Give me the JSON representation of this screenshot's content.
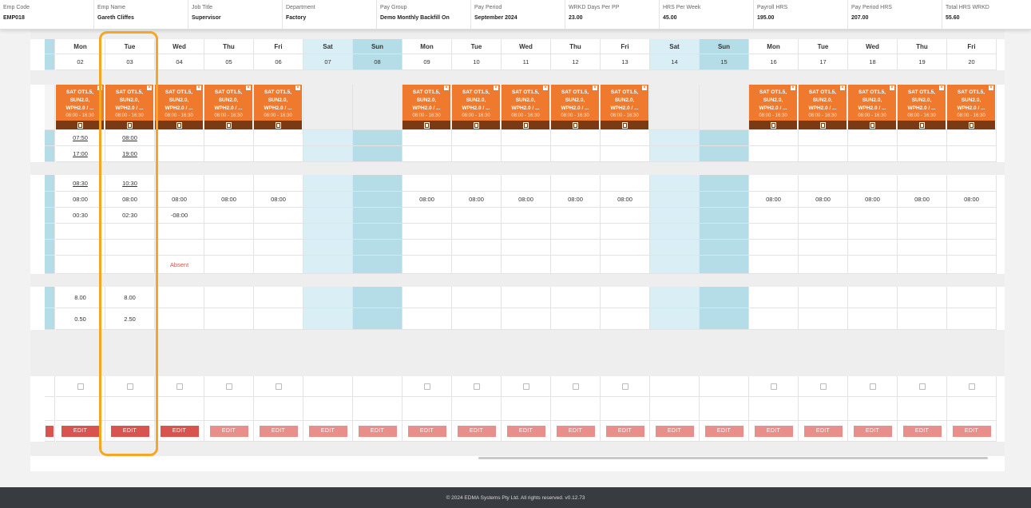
{
  "header": {
    "fields": [
      {
        "label": "Emp Code",
        "value": "EMP018"
      },
      {
        "label": "Emp Name",
        "value": "Gareth Cliffes"
      },
      {
        "label": "Job Title",
        "value": "Supervisor"
      },
      {
        "label": "Department",
        "value": "Factory"
      },
      {
        "label": "Pay Group",
        "value": "Demo Monthly Backfill On"
      },
      {
        "label": "Pay Period",
        "value": "September 2024"
      },
      {
        "label": "WRKD Days Per PP",
        "value": "23.00"
      },
      {
        "label": "HRS Per Week",
        "value": "45.00"
      },
      {
        "label": "Payroll HRS",
        "value": "195.00"
      },
      {
        "label": "Pay Period HRS",
        "value": "207.00"
      },
      {
        "label": "Total HRS WRKD",
        "value": "55.60"
      }
    ]
  },
  "days": [
    {
      "name": "Mon",
      "date": "02",
      "weekend": false,
      "roster": true,
      "start": "07:50",
      "end": "17:00",
      "start2": "08:30",
      "norm": "08:00",
      "diff": "00:30",
      "status": "",
      "hrs": "8.00",
      "ot": "0.50",
      "edit": "EDIT",
      "edit_active": true
    },
    {
      "name": "Tue",
      "date": "03",
      "weekend": false,
      "roster": true,
      "start": "08:00",
      "end": "19:00",
      "start2": "10:30",
      "norm": "08:00",
      "diff": "02:30",
      "status": "",
      "hrs": "8.00",
      "ot": "2.50",
      "edit": "EDIT",
      "edit_active": true
    },
    {
      "name": "Wed",
      "date": "04",
      "weekend": false,
      "roster": true,
      "start": "",
      "end": "",
      "start2": "",
      "norm": "08:00",
      "diff": "-08:00",
      "status": "Absent",
      "hrs": "",
      "ot": "",
      "edit": "EDIT",
      "edit_active": true
    },
    {
      "name": "Thu",
      "date": "05",
      "weekend": false,
      "roster": true,
      "start": "",
      "end": "",
      "start2": "",
      "norm": "08:00",
      "diff": "",
      "status": "",
      "hrs": "",
      "ot": "",
      "edit": "EDIT",
      "edit_active": false
    },
    {
      "name": "Fri",
      "date": "06",
      "weekend": false,
      "roster": true,
      "start": "",
      "end": "",
      "start2": "",
      "norm": "08:00",
      "diff": "",
      "status": "",
      "hrs": "",
      "ot": "",
      "edit": "EDIT",
      "edit_active": false
    },
    {
      "name": "Sat",
      "date": "07",
      "weekend": "sat",
      "roster": false,
      "start": "",
      "end": "",
      "start2": "",
      "norm": "",
      "diff": "",
      "status": "",
      "hrs": "",
      "ot": "",
      "edit": "EDIT",
      "edit_active": false
    },
    {
      "name": "Sun",
      "date": "08",
      "weekend": "sun",
      "roster": false,
      "start": "",
      "end": "",
      "start2": "",
      "norm": "",
      "diff": "",
      "status": "",
      "hrs": "",
      "ot": "",
      "edit": "EDIT",
      "edit_active": false
    },
    {
      "name": "Mon",
      "date": "09",
      "weekend": false,
      "roster": true,
      "start": "",
      "end": "",
      "start2": "",
      "norm": "08:00",
      "diff": "",
      "status": "",
      "hrs": "",
      "ot": "",
      "edit": "EDIT",
      "edit_active": false
    },
    {
      "name": "Tue",
      "date": "10",
      "weekend": false,
      "roster": true,
      "start": "",
      "end": "",
      "start2": "",
      "norm": "08:00",
      "diff": "",
      "status": "",
      "hrs": "",
      "ot": "",
      "edit": "EDIT",
      "edit_active": false
    },
    {
      "name": "Wed",
      "date": "11",
      "weekend": false,
      "roster": true,
      "start": "",
      "end": "",
      "start2": "",
      "norm": "08:00",
      "diff": "",
      "status": "",
      "hrs": "",
      "ot": "",
      "edit": "EDIT",
      "edit_active": false
    },
    {
      "name": "Thu",
      "date": "12",
      "weekend": false,
      "roster": true,
      "start": "",
      "end": "",
      "start2": "",
      "norm": "08:00",
      "diff": "",
      "status": "",
      "hrs": "",
      "ot": "",
      "edit": "EDIT",
      "edit_active": false
    },
    {
      "name": "Fri",
      "date": "13",
      "weekend": false,
      "roster": true,
      "start": "",
      "end": "",
      "start2": "",
      "norm": "08:00",
      "diff": "",
      "status": "",
      "hrs": "",
      "ot": "",
      "edit": "EDIT",
      "edit_active": false
    },
    {
      "name": "Sat",
      "date": "14",
      "weekend": "sat",
      "roster": false,
      "start": "",
      "end": "",
      "start2": "",
      "norm": "",
      "diff": "",
      "status": "",
      "hrs": "",
      "ot": "",
      "edit": "EDIT",
      "edit_active": false
    },
    {
      "name": "Sun",
      "date": "15",
      "weekend": "sun",
      "roster": false,
      "start": "",
      "end": "",
      "start2": "",
      "norm": "",
      "diff": "",
      "status": "",
      "hrs": "",
      "ot": "",
      "edit": "EDIT",
      "edit_active": false
    },
    {
      "name": "Mon",
      "date": "16",
      "weekend": false,
      "roster": true,
      "start": "",
      "end": "",
      "start2": "",
      "norm": "08:00",
      "diff": "",
      "status": "",
      "hrs": "",
      "ot": "",
      "edit": "EDIT",
      "edit_active": false
    },
    {
      "name": "Tue",
      "date": "17",
      "weekend": false,
      "roster": true,
      "start": "",
      "end": "",
      "start2": "",
      "norm": "08:00",
      "diff": "",
      "status": "",
      "hrs": "",
      "ot": "",
      "edit": "EDIT",
      "edit_active": false
    },
    {
      "name": "Wed",
      "date": "18",
      "weekend": false,
      "roster": true,
      "start": "",
      "end": "",
      "start2": "",
      "norm": "08:00",
      "diff": "",
      "status": "",
      "hrs": "",
      "ot": "",
      "edit": "EDIT",
      "edit_active": false
    },
    {
      "name": "Thu",
      "date": "19",
      "weekend": false,
      "roster": true,
      "start": "",
      "end": "",
      "start2": "",
      "norm": "08:00",
      "diff": "",
      "status": "",
      "hrs": "",
      "ot": "",
      "edit": "EDIT",
      "edit_active": false
    },
    {
      "name": "Fri",
      "date": "20",
      "weekend": false,
      "roster": true,
      "start": "",
      "end": "",
      "start2": "",
      "norm": "08:00",
      "diff": "",
      "status": "",
      "hrs": "",
      "ot": "",
      "edit": "EDIT",
      "edit_active": false
    }
  ],
  "roster_card": {
    "lines": [
      "SAT OT1.5,",
      "SUN2.0,",
      "WPH2.0 / ..."
    ],
    "time": "08:00 - 16:30"
  },
  "footer": {
    "text": "© 2024 EDMA Systems Pty Ltd. All rights reserved. v0.12.73"
  },
  "colors": {
    "roster_orange": "#ef7a2e",
    "roster_dark": "#7a3a14",
    "weekend_sat": "#daeef5",
    "weekend_sun": "#b5dde8",
    "edit_active": "#d9534f",
    "edit_inactive": "#e88e8b",
    "highlight": "#f5a623",
    "footer_bg": "#383c40"
  }
}
